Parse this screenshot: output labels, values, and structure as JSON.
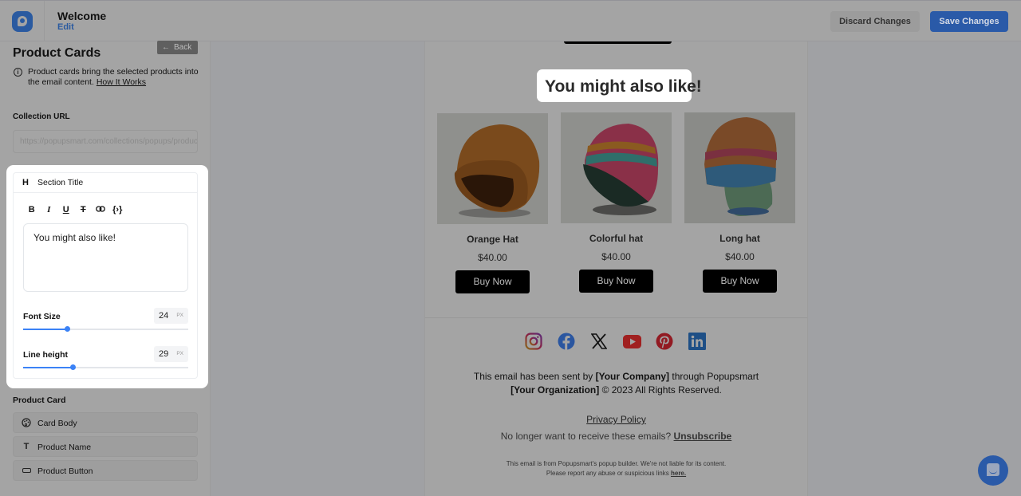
{
  "header": {
    "title": "Welcome",
    "edit_label": "Edit",
    "discard_label": "Discard Changes",
    "save_label": "Save Changes"
  },
  "sidebar": {
    "title": "Product Cards",
    "back_label": "Back",
    "info_text": "Product cards bring the selected products into the email content.",
    "info_link": "How It Works",
    "collection_url_label": "Collection URL",
    "collection_url_placeholder": "https://popupsmart.com/collections/popups/products",
    "section_title": {
      "label": "Section Title",
      "text": "You might also like!",
      "toolbar": [
        "bold",
        "italic",
        "underline",
        "strikethrough",
        "link",
        "variable"
      ],
      "font_size": {
        "label": "Font Size",
        "value": "24",
        "unit": "PX",
        "fraction": 0.27
      },
      "line_height": {
        "label": "Line height",
        "value": "29",
        "unit": "PX",
        "fraction": 0.3
      }
    },
    "product_card_label": "Product Card",
    "product_card_items": [
      {
        "icon": "palette-icon",
        "label": "Card Body"
      },
      {
        "icon": "text-icon",
        "label": "Product Name"
      },
      {
        "icon": "button-icon",
        "label": "Product Button"
      }
    ]
  },
  "email": {
    "heading": "You might also like!",
    "products": [
      {
        "name": "Orange Hat",
        "price": "$40.00",
        "button": "Buy Now"
      },
      {
        "name": "Colorful hat",
        "price": "$40.00",
        "button": "Buy Now"
      },
      {
        "name": "Long hat",
        "price": "$40.00",
        "button": "Buy Now"
      }
    ],
    "social": [
      "instagram",
      "facebook",
      "x",
      "youtube",
      "pinterest",
      "linkedin"
    ],
    "footer": {
      "sent_by_prefix": "This email has been sent by ",
      "company": "[Your Company]",
      "through": " through Popupsmart",
      "organization": "[Your Organization]",
      "rights": " © 2023 All Rights Reserved.",
      "privacy": "Privacy Policy",
      "unsub_prefix": "No longer want to receive these emails? ",
      "unsub_link": "Unsubscribe",
      "disclaimer": "This email is from Popupsmart's popup builder. We're not liable for its content.",
      "report_prefix": "Please report any abuse or suspicious links ",
      "report_link": "here."
    }
  },
  "colors": {
    "brand": "#2a5aa8",
    "slider": "#3b82f6",
    "overlay": "#a4a4a4"
  }
}
